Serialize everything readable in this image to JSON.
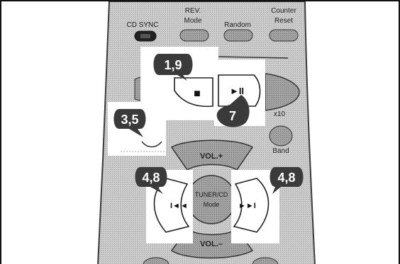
{
  "buttons": {
    "cd_sync": "CD SYNC",
    "rev_mode": [
      "REV.",
      "Mode"
    ],
    "random": "Random",
    "counter_reset": [
      "Counter",
      "Reset"
    ],
    "stop_symbol": "■",
    "play_pause_symbol": "►II",
    "skip_back_symbol": "I◄◄",
    "skip_forward_symbol": "►►I",
    "x10": "x10",
    "band": "Band",
    "vol_up": "VOL.+",
    "vol_down": "VOL.–",
    "tuner_cd_mode": [
      "TUNER/CD",
      "Mode"
    ],
    "cd_label": "CD"
  },
  "callouts": {
    "stop": "1,9",
    "play_pause": "7",
    "left_small": "3,5",
    "skip_back": "4,8",
    "skip_forward": "4,8"
  },
  "colors": {
    "remote_body": "#c9c9c9",
    "button_gray": "#a9a9a9",
    "button_dark": "#8a8a8a",
    "highlight": "#ffffff",
    "callout": "#3a3a3a",
    "frame": "#111111"
  }
}
